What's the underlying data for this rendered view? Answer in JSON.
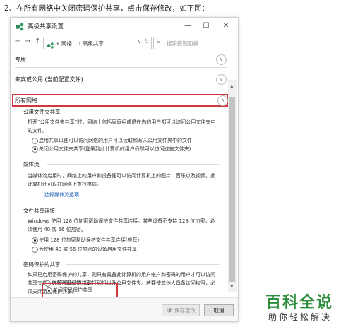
{
  "caption": "2、在所有网络中关闭密码保护共享，点击保存修改，如下图：",
  "window": {
    "title": "高级共享设置",
    "controls": {
      "minimize": "—",
      "maximize": "☐",
      "close": "✕"
    }
  },
  "addressbar": {
    "back": "←",
    "forward": "→",
    "up": "↑",
    "breadcrumb": "« 网络... › 高级共享...",
    "dropdown": "∨",
    "refresh": "↻",
    "search_placeholder": "搜索控制面板"
  },
  "sections": {
    "private": "专用",
    "guest": "来宾或公用 (当前配置文件)",
    "all": "所有网络",
    "chevron_down": "∨",
    "chevron_up": "∧"
  },
  "public_folder": {
    "heading": "公用文件夹共享",
    "description": "打开“公用文件夹共享”时，网络上包括家庭组成员在内的用户都可以访问公用文件夹中的文件。",
    "options": [
      {
        "label": "启用共享以便可以访问网络的用户可以读取和写入公用文件夹中的文件",
        "selected": false
      },
      {
        "label": "关闭公用文件夹共享(登录到此计算机的用户仍然可以访问这些文件夹)",
        "selected": true
      }
    ]
  },
  "media": {
    "heading": "媒体流",
    "description": "当媒体流启用时，网络上的用户和设备便可以访问计算机上的图片，音乐以及视频。此计算机还可以在网络上查找媒体。",
    "link": "选择媒体流选项..."
  },
  "file_sharing": {
    "heading": "文件共享连接",
    "description": "Windows 使用 128 位加密帮助保护文件共享连接。某些设备不支持 128 位加密，必须使用 40 或 56 位加密。",
    "options": [
      {
        "label": "使用 128 位加密帮助保护文件共享连接(推荐)",
        "selected": true
      },
      {
        "label": "为使用 40 或 56 位加密的设备启用文件共享",
        "selected": false
      }
    ]
  },
  "password": {
    "heading": "密码保护的共享",
    "description": "如果已启用密码保护的共享，则只有具备此计算机的用户帐户和密码的用户才可以访问共享文件、连接到此计算机的打印机以及公用文件夹。若要使其他人具备访问权限，必须关闭密码保护共享。",
    "options": [
      {
        "label": "启用密码保护共享",
        "selected": false
      },
      {
        "label": "关闭密码保护共享",
        "selected": true
      }
    ]
  },
  "footer": {
    "save": "保存更改",
    "cancel": "取消"
  },
  "watermark": {
    "title": "百科全说",
    "subtitle": "助你轻松解决"
  },
  "colors": {
    "highlight": "#d0383d",
    "link": "#1a5fb4",
    "brand": "#2d8f3d"
  }
}
